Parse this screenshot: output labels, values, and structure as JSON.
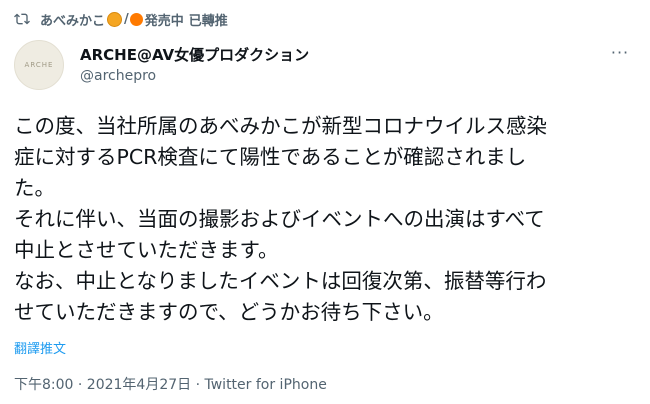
{
  "retweet": {
    "name": "あべみかこ",
    "status": "発売中",
    "label": "已轉推"
  },
  "author": {
    "display_name": "ARCHE@AV女優プロダクション",
    "handle": "@archepro",
    "avatar_text": "ARCHE"
  },
  "tweet": {
    "lines": [
      "この度、当社所属のあべみかこが新型コロナウイルス感染",
      "症に対するPCR検査にて陽性であることが確認されまし",
      "た。",
      "それに伴い、当面の撮影およびイベントへの出演はすべて",
      "中止とさせていただきます。",
      "なお、中止となりましたイベントは回復次第、振替等行わ",
      "せていただきますので、どうかお待ち下さい。"
    ],
    "translate_label": "翻譯推文",
    "meta": "下午8:00 · 2021年4月27日 · Twitter for iPhone"
  },
  "colors": {
    "text": "#0f1419",
    "secondary": "#536471",
    "link": "#1d9bf0"
  }
}
